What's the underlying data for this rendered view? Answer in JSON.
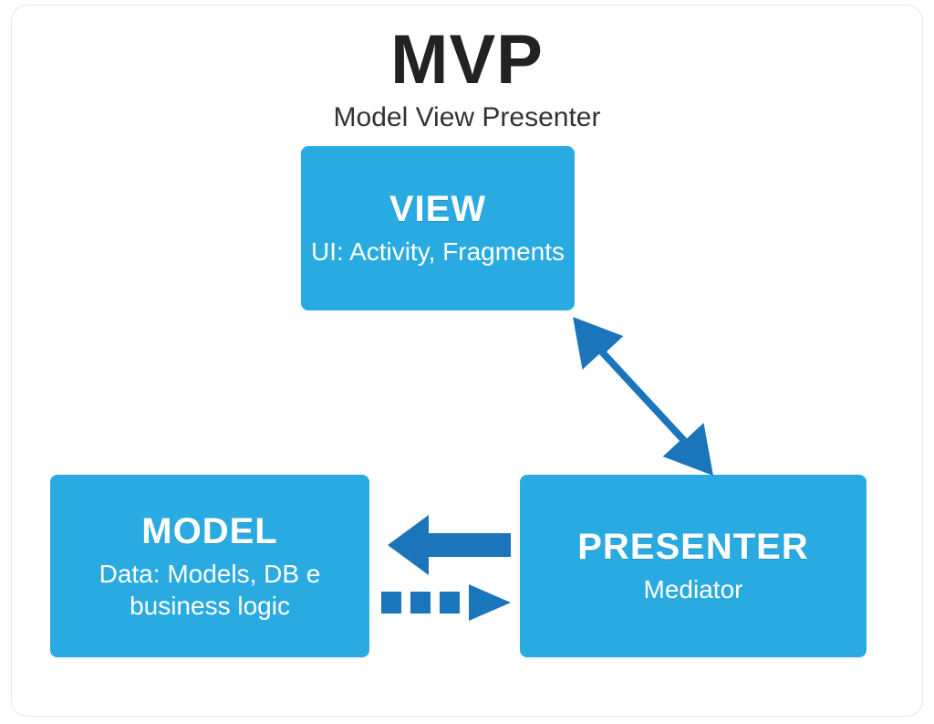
{
  "title": "MVP",
  "subtitle": "Model View Presenter",
  "colors": {
    "box_fill": "#29abe2",
    "arrow_fill": "#1b75bb"
  },
  "boxes": {
    "view": {
      "title": "VIEW",
      "subtitle": "UI: Activity, Fragments"
    },
    "model": {
      "title": "MODEL",
      "subtitle": "Data: Models, DB e business logic"
    },
    "presenter": {
      "title": "PRESENTER",
      "subtitle": "Mediator"
    }
  },
  "arrows": [
    {
      "from": "view",
      "to": "presenter",
      "style": "solid",
      "bidirectional": true
    },
    {
      "from": "presenter",
      "to": "model",
      "style": "solid",
      "bidirectional": false
    },
    {
      "from": "model",
      "to": "presenter",
      "style": "dashed",
      "bidirectional": false
    }
  ]
}
